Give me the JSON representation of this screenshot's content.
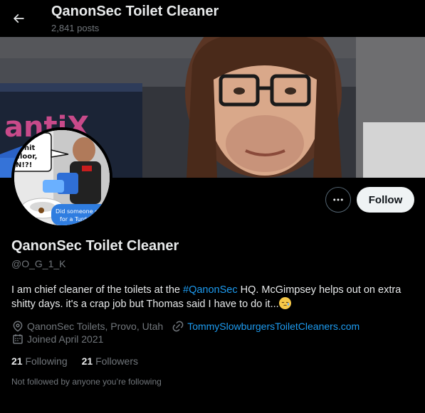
{
  "header": {
    "title": "QanonSec Toilet Cleaner",
    "post_count": "2,841 posts"
  },
  "profile": {
    "display_name": "QanonSec Toilet Cleaner",
    "handle": "@O_G_1_K",
    "bio_before": "I am chief cleaner of the toilets at the ",
    "bio_hashtag": "#QanonSec",
    "bio_after": " HQ. McGimpsey helps out on extra shitty days. it's a crap job but Thomas said I have to do it...",
    "location": "QanonSec Toilets, Provo, Utah",
    "website": "TommySlowburgersToiletCleaners.com",
    "joined": "Joined April 2021",
    "following_count": "21",
    "following_label": "Following",
    "followers_count": "21",
    "followers_label": "Followers",
    "not_followed_note": "Not followed by anyone you’re following"
  },
  "actions": {
    "follow_label": "Follow"
  },
  "banner": {
    "screen_text": "antiX"
  },
  "avatar": {
    "bubble_text": [
      "s!",
      "shit",
      "floor,",
      "N!?!"
    ],
    "caption_text": [
      "Did someone c",
      "for a Turdo"
    ]
  },
  "colors": {
    "background": "#000000",
    "text_primary": "#e7e9ea",
    "text_secondary": "#71767b",
    "accent": "#1d9bf0",
    "follow_button_bg": "#eff3f4"
  },
  "icons": {
    "back": "arrow-left-icon",
    "more": "more-horizontal-icon",
    "location": "location-pin-icon",
    "link": "link-icon",
    "calendar": "calendar-icon"
  }
}
